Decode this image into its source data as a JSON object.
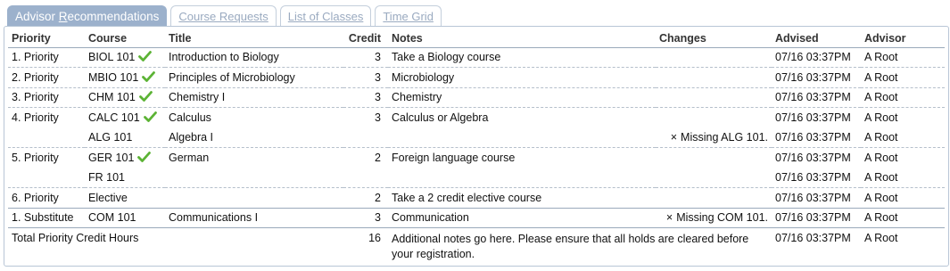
{
  "tabs": {
    "advisor_pre": "Advisor ",
    "advisor_ul": "R",
    "advisor_post": "ecommendations",
    "requests": "Course Requests",
    "classes": "List of Classes",
    "timegrid": "Time Grid"
  },
  "columns": {
    "priority": "Priority",
    "course": "Course",
    "title": "Title",
    "credit": "Credit",
    "notes": "Notes",
    "changes": "Changes",
    "advised": "Advised",
    "advisor": "Advisor"
  },
  "rows": [
    {
      "priority": "1. Priority",
      "course": "BIOL 101",
      "title": "Introduction to Biology",
      "credit": "3",
      "notes": "Take a Biology course",
      "changes": "",
      "advised": "07/16 03:37PM",
      "advisor": "A Root"
    },
    {
      "priority": "2. Priority",
      "course": "MBIO 101",
      "title": "Principles of Microbiology",
      "credit": "3",
      "notes": "Microbiology",
      "changes": "",
      "advised": "07/16 03:37PM",
      "advisor": "A Root"
    },
    {
      "priority": "3. Priority",
      "course": "CHM 101",
      "title": "Chemistry I",
      "credit": "3",
      "notes": "Chemistry",
      "changes": "",
      "advised": "07/16 03:37PM",
      "advisor": "A Root"
    },
    {
      "priority": "4. Priority",
      "course": "CALC 101",
      "title": "Calculus",
      "credit": "3",
      "notes": "Calculus or Algebra",
      "changes": "",
      "advised": "07/16 03:37PM",
      "advisor": "A Root"
    },
    {
      "priority": "",
      "course": "ALG 101",
      "title": "Algebra I",
      "credit": "",
      "notes": "",
      "changes_x": "×",
      "changes": "Missing ALG 101.",
      "advised": "07/16 03:37PM",
      "advisor": "A Root"
    },
    {
      "priority": "5. Priority",
      "course": "GER 101",
      "title": "German",
      "credit": "2",
      "notes": "Foreign language course",
      "changes": "",
      "advised": "07/16 03:37PM",
      "advisor": "A Root"
    },
    {
      "priority": "",
      "course": "FR 101",
      "title": "",
      "credit": "",
      "notes": "",
      "changes": "",
      "advised": "07/16 03:37PM",
      "advisor": "A Root"
    },
    {
      "priority": "6. Priority",
      "course": "Elective",
      "title": "",
      "credit": "2",
      "notes": "Take a 2 credit elective course",
      "changes": "",
      "advised": "07/16 03:37PM",
      "advisor": "A Root"
    },
    {
      "priority": "1. Substitute",
      "course": "COM 101",
      "title": "Communications I",
      "credit": "3",
      "notes": "Communication",
      "changes_x": "×",
      "changes": "Missing COM 101.",
      "advised": "07/16 03:37PM",
      "advisor": "A Root"
    }
  ],
  "total": {
    "label": "Total Priority Credit Hours",
    "credit": "16",
    "notes": "Additional notes go here. Please ensure that all holds are cleared before your registration.",
    "advised": "07/16 03:37PM",
    "advisor": "A Root"
  },
  "icons": {
    "check": "check-icon",
    "check_color": "#5cb335"
  }
}
